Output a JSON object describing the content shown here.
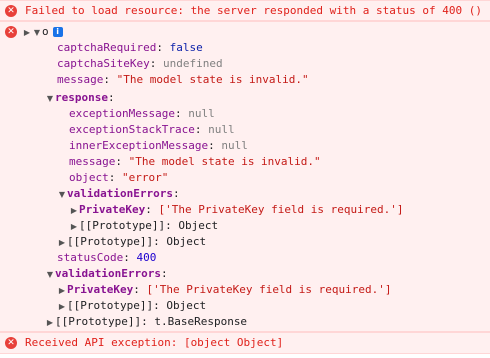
{
  "console": {
    "error1": {
      "icon": "error-icon",
      "text": "Failed to load resource: the server responded with a status of 400 ()"
    },
    "object_header": {
      "icon": "error-icon",
      "label": "o",
      "info_badge": "i"
    },
    "lines": {
      "captchaRequired_key": "captchaRequired",
      "captchaRequired_val": "false",
      "captchaSiteKey_key": "captchaSiteKey",
      "captchaSiteKey_val": "undefined",
      "message_key": "message",
      "message_val": "\"The model state is invalid.\"",
      "response_key": "response",
      "exceptionMessage_key": "exceptionMessage",
      "exceptionMessage_val": "null",
      "exceptionStackTrace_key": "exceptionStackTrace",
      "exceptionStackTrace_val": "null",
      "innerExceptionMessage_key": "innerExceptionMessage",
      "innerExceptionMessage_val": "null",
      "response_message_key": "message",
      "response_message_val": "\"The model state is invalid.\"",
      "object_key": "object",
      "object_val": "\"error\"",
      "validationErrors_key": "validationErrors",
      "privateKey_key": "PrivateKey",
      "privateKey_val": "['The PrivateKey field is required.']",
      "prototype_key": "[[Prototype]]",
      "prototype_val": "Object",
      "response_prototype_key": "[[Prototype]]",
      "response_prototype_val": "Object",
      "statusCode_key": "statusCode",
      "statusCode_val": "400",
      "validationErrors2_key": "validationErrors",
      "privateKey2_key": "PrivateKey",
      "privateKey2_val": "['The PrivateKey field is required.']",
      "prototype2_key": "[[Prototype]]",
      "prototype2_val": "Object",
      "root_prototype_key": "[[Prototype]]",
      "root_prototype_val": "t.BaseResponse"
    },
    "error2": {
      "icon": "error-icon",
      "text": "Received API exception: [object Object]"
    }
  },
  "colors": {
    "error_bg": "#fff0f0",
    "error_text": "#e0211b",
    "key": "#881391",
    "string": "#c41a16",
    "number": "#1c00cf",
    "keyword": "#0d22aa",
    "null": "#808080"
  }
}
